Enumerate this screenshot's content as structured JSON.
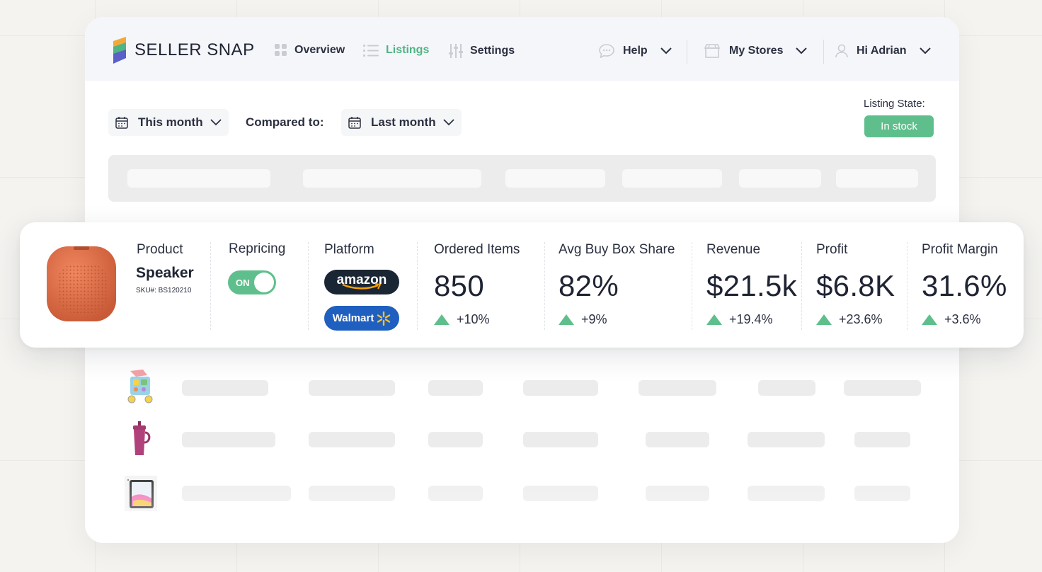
{
  "app": {
    "name": "SELLER SNAP",
    "nav": [
      {
        "label": "Overview",
        "icon": "grid-icon",
        "active": false
      },
      {
        "label": "Listings",
        "icon": "list-icon",
        "active": true
      },
      {
        "label": "Settings",
        "icon": "sliders-icon",
        "active": false
      }
    ],
    "help_label": "Help",
    "stores_label": "My Stores",
    "user_label": "Hi Adrian"
  },
  "filters": {
    "period_label": "This month",
    "compared_label": "Compared to:",
    "compare_period_label": "Last month",
    "listing_state_label": "Listing State:",
    "listing_state_value": "In stock"
  },
  "highlight": {
    "product_header": "Product",
    "product_name": "Speaker",
    "sku": "SKU#: BS120210",
    "repricing_header": "Repricing",
    "repricing_toggle": "ON",
    "platform_header": "Platform",
    "platforms": [
      "amazon",
      "Walmart"
    ],
    "metrics": [
      {
        "title": "Ordered Items",
        "value": "850",
        "delta": "+10%"
      },
      {
        "title": "Avg Buy Box Share",
        "value": "82%",
        "delta": "+9%"
      },
      {
        "title": "Revenue",
        "value": "$21.5k",
        "delta": "+19.4%"
      },
      {
        "title": "Profit",
        "value": "$6.8K",
        "delta": "+23.6%"
      },
      {
        "title": "Profit Margin",
        "value": "31.6%",
        "delta": "+3.6%"
      }
    ]
  },
  "rows": [
    {
      "thumb": "baby-walker-toy-icon"
    },
    {
      "thumb": "tumbler-cup-icon"
    },
    {
      "thumb": "tablet-icon"
    }
  ],
  "colors": {
    "accent_green": "#5fbf8c",
    "nav_active": "#4fb584",
    "amazon_bg": "#1b2634",
    "walmart_bg": "#1f5fbf",
    "walmart_spark": "#ffc220",
    "amazon_smile": "#f7a200",
    "speaker": "#e8734d"
  }
}
